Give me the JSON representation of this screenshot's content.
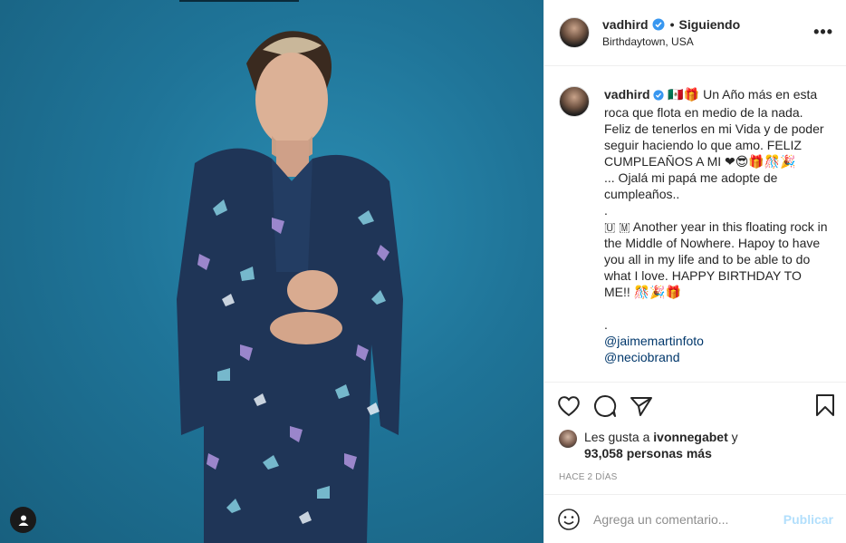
{
  "post": {
    "username": "vadhird",
    "follow_status": "Siguiendo",
    "location": "Birthdaytown, USA",
    "more_icon": "more-options-icon"
  },
  "caption": {
    "username": "vadhird",
    "lines": [
      "🇲🇽🎁 Un Año más en esta roca que flota en medio de la nada. Feliz de tenerlos en mi Vida y de poder seguir haciendo lo que amo. FELIZ CUMPLEAÑOS A MI ❤😎🎁🎊🎉",
      "... Ojalá mi papá me adopte de cumpleaños..",
      ".",
      "🇺 🇲 Another year in this floating rock in the Middle of Nowhere. Hapoy to have you all in my life and to be able to do what I love. HAPPY BIRTHDAY TO ME!! 🎊🎉🎁"
    ],
    "dot2": ".",
    "mentions": [
      "@jaimemartinfoto",
      "@neciobrand"
    ]
  },
  "likes": {
    "prefix": "Les gusta a",
    "user": "ivonnegabet",
    "conj": "y",
    "count": "93,058 personas más"
  },
  "timeago": "HACE 2 DÍAS",
  "comment": {
    "placeholder": "Agrega un comentario...",
    "publish": "Publicar"
  },
  "colors": {
    "verified": "#3897f0",
    "publish_disabled": "#b2dffc",
    "photo_background": "#1f7498"
  }
}
